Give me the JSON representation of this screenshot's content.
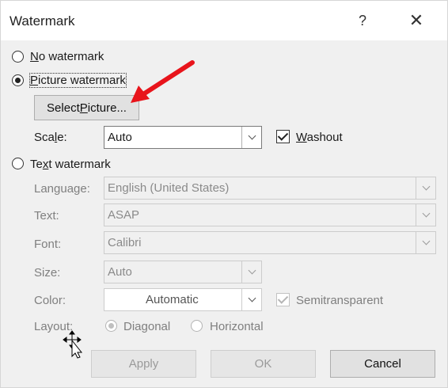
{
  "dialog": {
    "title": "Watermark",
    "help_glyph": "?",
    "close_glyph": "✕"
  },
  "options": {
    "no_watermark": {
      "pre": "",
      "key": "N",
      "post": "o watermark",
      "selected": false
    },
    "picture_watermark": {
      "pre": "",
      "key": "P",
      "post": "icture watermark",
      "selected": true
    },
    "text_watermark": {
      "pre": "Te",
      "key": "x",
      "post": "t watermark",
      "selected": false
    }
  },
  "picture": {
    "select_button": {
      "pre": "Select ",
      "key": "P",
      "post": "icture..."
    },
    "scale_label": {
      "pre": "Sca",
      "key": "l",
      "post": "e:"
    },
    "scale_value": "Auto",
    "washout": {
      "pre": "",
      "key": "W",
      "post": "ashout",
      "checked": true
    }
  },
  "text_fields": {
    "language_label": "Language:",
    "language_value": "English (United States)",
    "text_label": "Text:",
    "text_value": "ASAP",
    "font_label": "Font:",
    "font_value": "Calibri",
    "size_label": "Size:",
    "size_value": "Auto",
    "color_label": "Color:",
    "color_value": "Automatic",
    "semitransparent_label": "Semitransparent",
    "semitransparent_checked": true,
    "layout_label": "Layout:",
    "layout_diagonal": "Diagonal",
    "layout_horizontal": "Horizontal",
    "layout_selected": "Diagonal"
  },
  "buttons": {
    "apply": "Apply",
    "ok": "OK",
    "cancel": "Cancel"
  },
  "annotation": {
    "arrow_color": "#e8141b"
  }
}
